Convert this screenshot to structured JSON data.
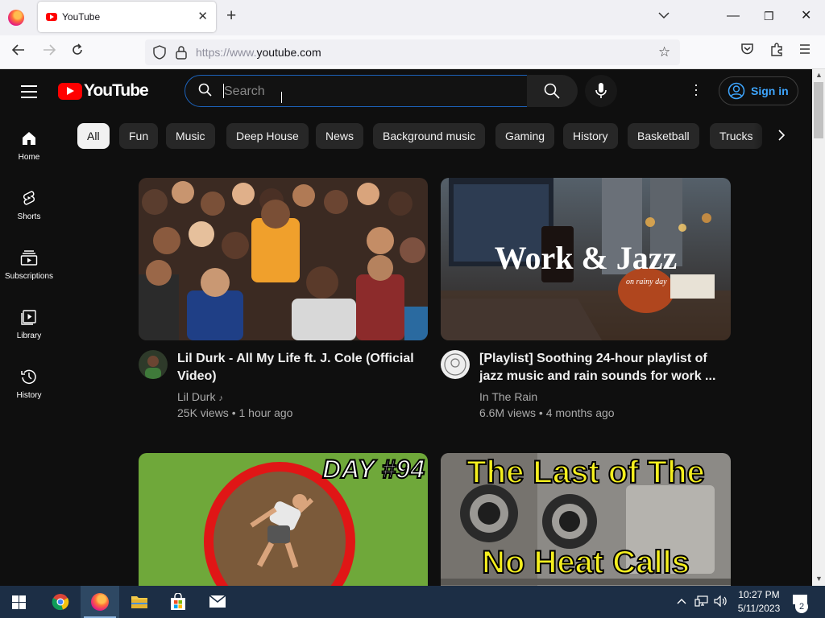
{
  "browser": {
    "tab_title": "YouTube",
    "url_prefix": "https://www.",
    "url_domain": "youtube.com"
  },
  "youtube": {
    "logo_text": "YouTube",
    "search_placeholder": "Search",
    "sign_in": "Sign in",
    "sidebar": [
      {
        "label": "Home",
        "icon": "home-icon"
      },
      {
        "label": "Shorts",
        "icon": "shorts-icon"
      },
      {
        "label": "Subscriptions",
        "icon": "subscriptions-icon"
      },
      {
        "label": "Library",
        "icon": "library-icon"
      },
      {
        "label": "History",
        "icon": "history-icon"
      }
    ],
    "chips": [
      "All",
      "Fun",
      "Music",
      "Deep House",
      "News",
      "Background music",
      "Gaming",
      "History",
      "Basketball",
      "Trucks"
    ],
    "videos": [
      {
        "title": "Lil Durk - All My Life ft. J. Cole (Official Video)",
        "channel": "Lil Durk",
        "channel_badge": "♪",
        "views": "25K views",
        "age": "1 hour ago"
      },
      {
        "title": "[Playlist] Soothing 24-hour playlist of jazz music and rain sounds for work ...",
        "channel": "In The Rain",
        "views": "6.6M views",
        "age": "4 months ago",
        "thumb_text": "Work & Jazz",
        "thumb_subtext": "on rainy day"
      },
      {
        "thumb_text": "DAY #94"
      },
      {
        "thumb_text_1": "The Last of The",
        "thumb_text_2": "No Heat Calls"
      }
    ]
  },
  "taskbar": {
    "time": "10:27 PM",
    "date": "5/11/2023",
    "notifications": "2"
  },
  "colors": {
    "yt_background": "#0f0f0f",
    "yt_red": "#ff0000",
    "link_blue": "#3ea6ff",
    "taskbar": "#1c2e45"
  }
}
